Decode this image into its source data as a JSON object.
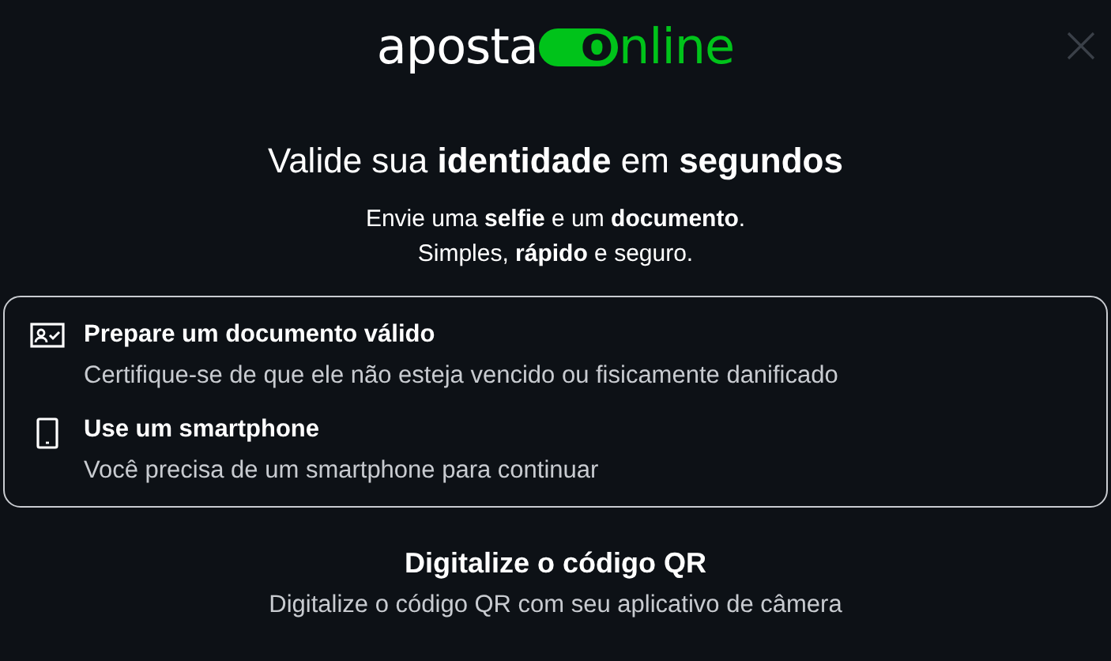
{
  "logo": {
    "first": "aposta",
    "badge": "o",
    "last": "nline"
  },
  "title": "Valide sua **identidade** em **segundos**",
  "subtitle_lines": [
    "Envie uma **selfie** e um **documento**.",
    "Simples, **rápido** e seguro."
  ],
  "requirements": [
    {
      "kind": "document",
      "title": "Prepare um documento válido",
      "description": "Certifique-se de que ele não esteja vencido ou fisicamente danificado"
    },
    {
      "kind": "phone",
      "title": "Use um smartphone",
      "description": "Você precisa de um smartphone para continuar"
    }
  ],
  "qr": {
    "title": "Digitalize o código QR",
    "description": "Digitalize o código QR com seu aplicativo de câmera"
  }
}
